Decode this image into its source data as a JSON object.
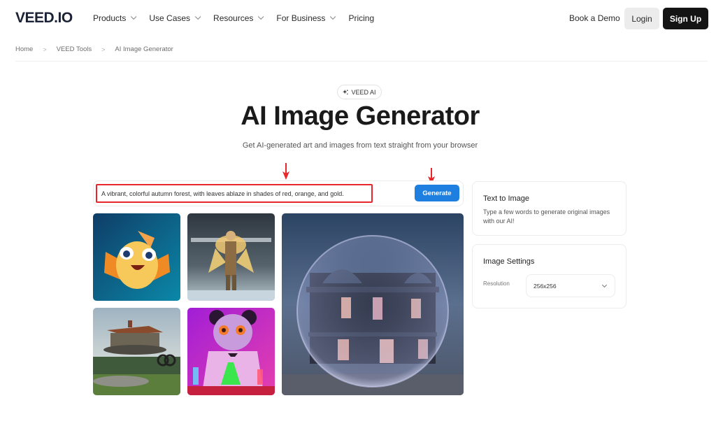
{
  "header": {
    "logo": "VEED.IO",
    "nav": [
      {
        "label": "Products",
        "has_dropdown": true
      },
      {
        "label": "Use Cases",
        "has_dropdown": true
      },
      {
        "label": "Resources",
        "has_dropdown": true
      },
      {
        "label": "For Business",
        "has_dropdown": true
      },
      {
        "label": "Pricing",
        "has_dropdown": false
      }
    ],
    "book_demo": "Book a Demo",
    "login": "Login",
    "signup": "Sign Up"
  },
  "breadcrumb": [
    "Home",
    "VEED Tools",
    "AI Image Generator"
  ],
  "hero": {
    "badge": "VEED AI",
    "badge_icon": "sparkle-icon",
    "title": "AI Image Generator",
    "subtitle": "Get AI-generated art and images from text straight from your browser"
  },
  "prompt": {
    "value": "A vibrant, colorful autumn forest, with leaves ablaze in shades of red, orange, and gold.",
    "generate_label": "Generate"
  },
  "gallery": [
    {
      "name": "cartoon-fish",
      "alt": "Cartoon fish"
    },
    {
      "name": "winged-knight",
      "alt": "Winged knight"
    },
    {
      "name": "bubble-house",
      "alt": "House inside a bubble"
    },
    {
      "name": "floating-house",
      "alt": "Floating house"
    },
    {
      "name": "scientist-panda",
      "alt": "Scientist panda"
    }
  ],
  "text_to_image": {
    "title": "Text to Image",
    "description": "Type a few words to generate original images with our AI!"
  },
  "image_settings": {
    "title": "Image Settings",
    "resolution_label": "Resolution",
    "resolution_value": "256x256"
  },
  "colors": {
    "accent": "#1f7fe0",
    "annotation_red": "#e8262b",
    "signup_bg": "#141414"
  }
}
